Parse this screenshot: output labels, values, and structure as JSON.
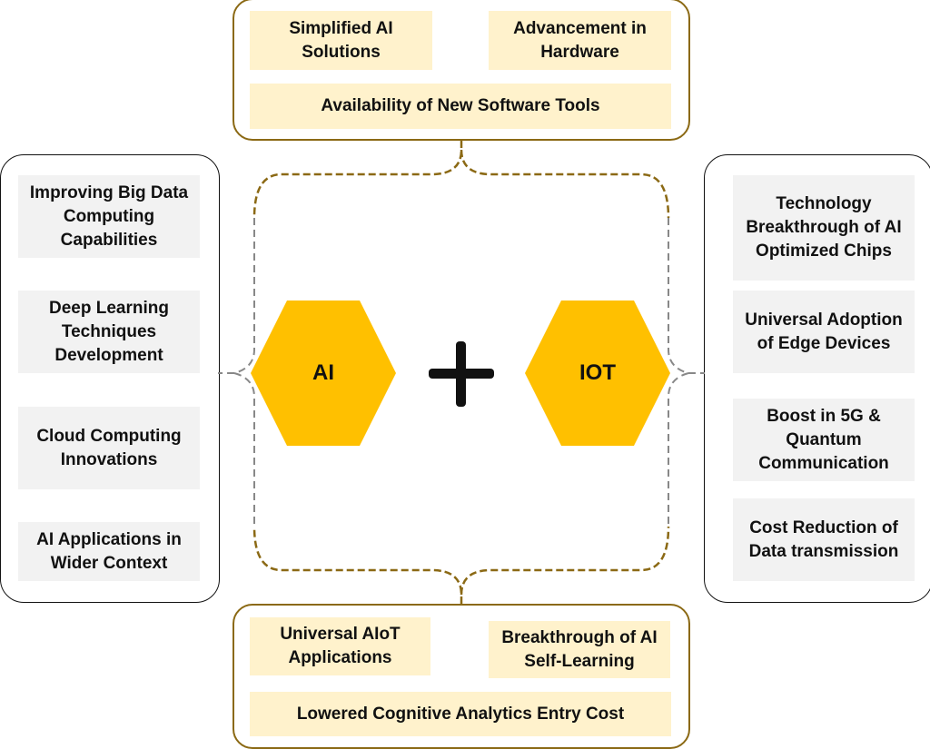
{
  "colors": {
    "accent": "#ffc000",
    "brown": "#8b6914",
    "cream": "#fff2cc",
    "gray": "#f2f2f2"
  },
  "top": {
    "items": [
      "Simplified AI Solutions",
      "Advancement in Hardware",
      "Availability of New Software Tools"
    ]
  },
  "bottom": {
    "items": [
      "Universal AIoT Applications",
      "Breakthrough of AI Self-Learning",
      "Lowered Cognitive Analytics Entry Cost"
    ]
  },
  "left": {
    "items": [
      "Improving Big Data Computing Capabilities",
      "Deep Learning Techniques Development",
      "Cloud Computing Innovations",
      "AI Applications in Wider Context"
    ]
  },
  "right": {
    "items": [
      "Technology Breakthrough of AI Optimized Chips",
      "Universal Adoption of Edge Devices",
      "Boost in 5G & Quantum Communication",
      "Cost Reduction of Data transmission"
    ]
  },
  "center": {
    "left_hex": "AI",
    "operator": "+",
    "right_hex": "IOT"
  }
}
